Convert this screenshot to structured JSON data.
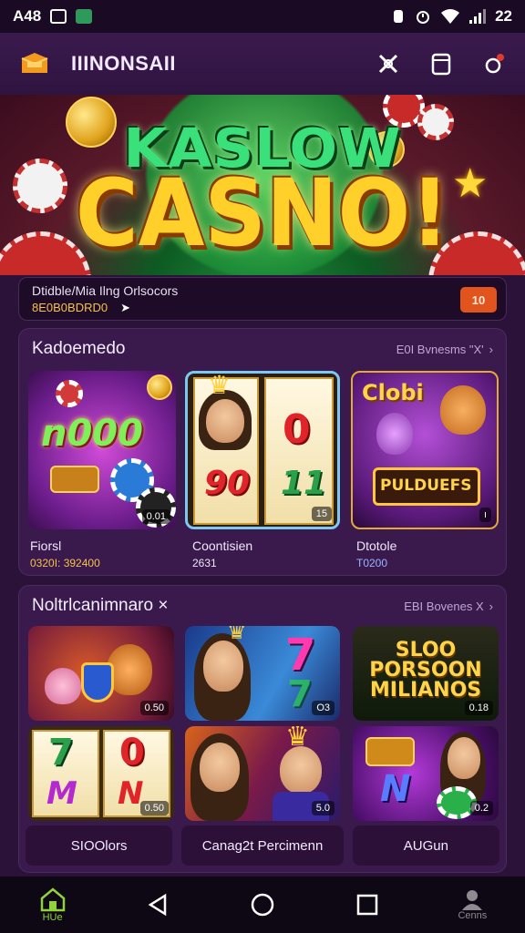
{
  "status_bar": {
    "time": "A48",
    "right_value": "22"
  },
  "app": {
    "title": "IIINONSAII"
  },
  "hero": {
    "line1": "KASLOW",
    "line2": "CASNO!"
  },
  "notice": {
    "line1": "Dtidble/Mia Ilng Orlsocors",
    "line2": "8E0B0BDRD0",
    "badge": "10"
  },
  "section1": {
    "title": "Kadoemedo",
    "more": "E0I Bvnesms \"X'",
    "games": [
      {
        "label": "Fiorsl",
        "sub": "0320I: 392400",
        "sub_color": "#f5c24a",
        "art": "n000",
        "tag": "0.01"
      },
      {
        "label": "Coontisien",
        "sub": "2631",
        "sub_color": "#f0e6fa",
        "art": "0",
        "tag": "15"
      },
      {
        "label": "Dtotole",
        "sub": "T0200",
        "sub_color": "#9ab4ff",
        "art": "Clobi",
        "tag": "ı"
      }
    ],
    "reel_text": "90",
    "reel_text2": "11",
    "banner_text": "PULDUEFS"
  },
  "section2": {
    "title": "Noltrlcanimnaro ×",
    "more": "EBI Bovenes X",
    "tiles": [
      {
        "tag": "0.50"
      },
      {
        "tag": "O3"
      },
      {
        "text1": "SLOO",
        "text2": "PORSOON",
        "text3": "MILIANOS",
        "tag": "0.18"
      },
      {
        "tag": "0.50"
      },
      {
        "tag": "5.0"
      },
      {
        "tag": "0.2"
      }
    ],
    "reel_7": "7",
    "reel_0": "0",
    "reel_m": "M",
    "reel_n": "N",
    "bottom_labels": [
      "SIOOlors",
      "Canag2t Percimenn",
      "AUGun"
    ]
  },
  "navbar": {
    "home_label": "HUe",
    "profile_label": "Cenns"
  }
}
